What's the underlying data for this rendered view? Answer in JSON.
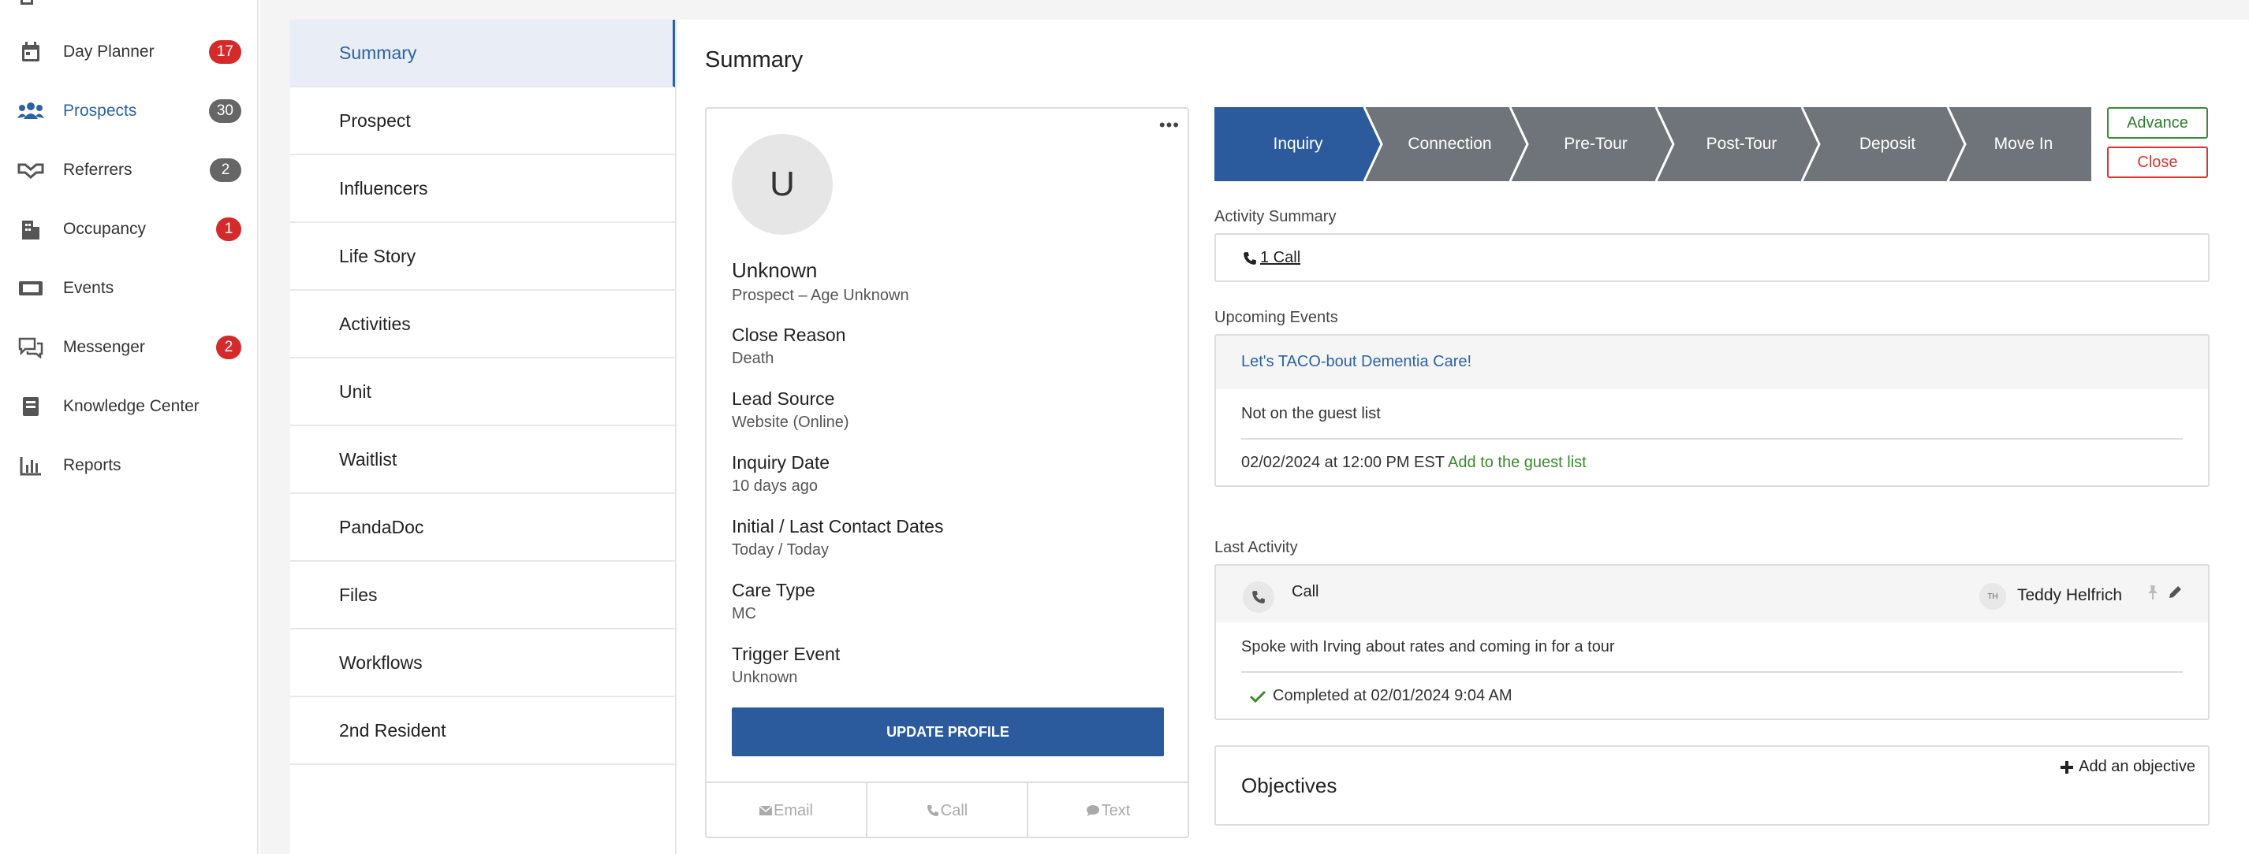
{
  "nav": {
    "items": [
      {
        "label": "Day Planner",
        "icon": "calendar-icon",
        "badge": "17",
        "badge_color": "#d42a2a"
      },
      {
        "label": "Prospects",
        "icon": "people-icon",
        "badge": "30",
        "badge_color": "#666666",
        "active": true
      },
      {
        "label": "Referrers",
        "icon": "handshake-icon",
        "badge": "2",
        "badge_color": "#666666"
      },
      {
        "label": "Occupancy",
        "icon": "building-icon",
        "badge": "1",
        "badge_color": "#d42a2a"
      },
      {
        "label": "Events",
        "icon": "ticket-icon",
        "badge": ""
      },
      {
        "label": "Messenger",
        "icon": "chat-icon",
        "badge": "2",
        "badge_color": "#d42a2a"
      },
      {
        "label": "Knowledge Center",
        "icon": "book-icon",
        "badge": ""
      },
      {
        "label": "Reports",
        "icon": "bar-chart-icon",
        "badge": ""
      }
    ]
  },
  "sections": [
    {
      "label": "Summary",
      "active": true
    },
    {
      "label": "Prospect"
    },
    {
      "label": "Influencers"
    },
    {
      "label": "Life Story"
    },
    {
      "label": "Activities"
    },
    {
      "label": "Unit"
    },
    {
      "label": "Waitlist"
    },
    {
      "label": "PandaDoc"
    },
    {
      "label": "Files"
    },
    {
      "label": "Workflows"
    },
    {
      "label": "2nd Resident"
    }
  ],
  "page_title": "Summary",
  "profile": {
    "initial": "U",
    "name": "Unknown",
    "subtitle": "Prospect – Age Unknown",
    "fields": [
      {
        "label": "Close Reason",
        "value": "Death"
      },
      {
        "label": "Lead Source",
        "value": "Website (Online)"
      },
      {
        "label": "Inquiry Date",
        "value": "10 days ago"
      },
      {
        "label": "Initial / Last Contact Dates",
        "value": "Today / Today"
      },
      {
        "label": "Care Type",
        "value": "MC"
      },
      {
        "label": "Trigger Event",
        "value": "Unknown"
      }
    ],
    "update_label": "UPDATE PROFILE",
    "contact": {
      "email": "Email",
      "call": "Call",
      "text": "Text"
    },
    "more": "•••"
  },
  "stepper": {
    "steps": [
      "Inquiry",
      "Connection",
      "Pre-Tour",
      "Post-Tour",
      "Deposit",
      "Move In"
    ],
    "active_index": 0,
    "active_color": "#2b5b9c",
    "inactive_color": "#6e7479"
  },
  "actions": {
    "advance": "Advance",
    "close": "Close"
  },
  "activity_summary": {
    "label": "Activity Summary",
    "link": "1 Call"
  },
  "upcoming_events": {
    "label": "Upcoming Events",
    "title": "Let's TACO-bout Dementia Care!",
    "status": "Not on the guest list",
    "datetime": "02/02/2024 at 12:00 PM EST",
    "add_link": "Add to the guest list"
  },
  "last_activity": {
    "label": "Last Activity",
    "type": "Call",
    "user_initials": "TH",
    "user_name": "Teddy Helfrich",
    "note": "Spoke with Irving about rates and coming in for a tour",
    "completed": "Completed at 02/01/2024 9:04 AM"
  },
  "objectives": {
    "title": "Objectives",
    "add": "Add an objective"
  }
}
